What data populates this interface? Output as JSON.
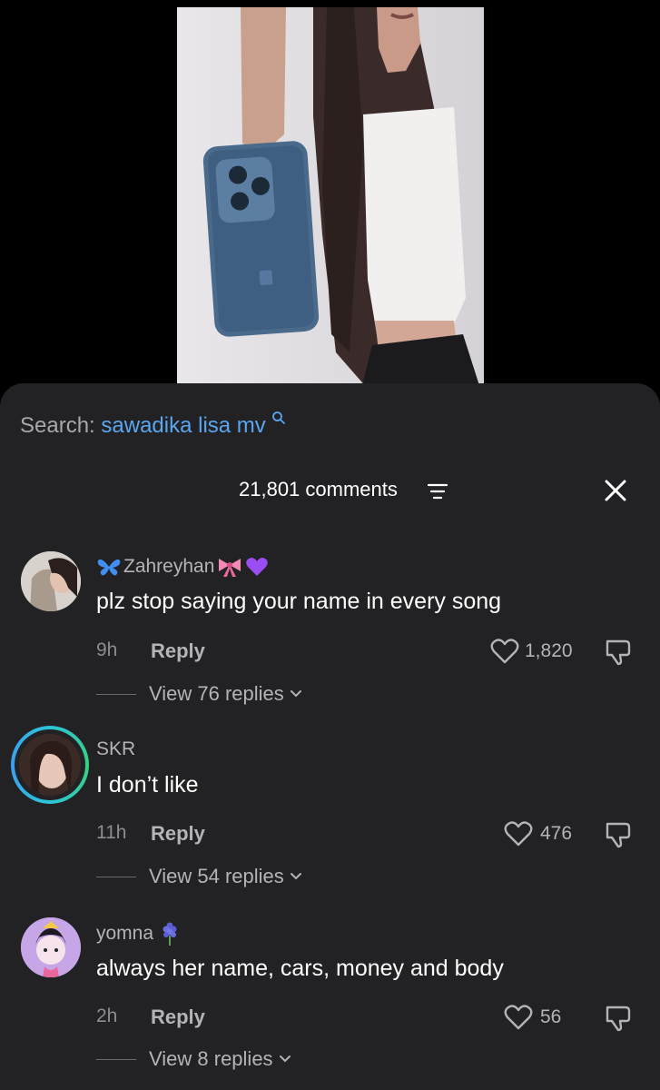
{
  "search": {
    "label": "Search:",
    "term": "sawadika lisa mv"
  },
  "header": {
    "comment_count": "21,801 comments"
  },
  "comments": [
    {
      "username": "Zahreyhan",
      "text": "plz stop saying your name in every song",
      "time": "9h",
      "reply": "Reply",
      "likes": "1,820",
      "view_replies": "View 76 replies"
    },
    {
      "username": "SKR",
      "text": "I don’t like",
      "time": "11h",
      "reply": "Reply",
      "likes": "476",
      "view_replies": "View 54 replies"
    },
    {
      "username": "yomna",
      "text": "always her name, cars, money and body",
      "time": "2h",
      "reply": "Reply",
      "likes": "56",
      "view_replies": "View 8 replies"
    }
  ],
  "colors": {
    "sheet_bg": "#222123",
    "search_term": "#5aa6f0",
    "story_ring": "#2ec4d6"
  }
}
